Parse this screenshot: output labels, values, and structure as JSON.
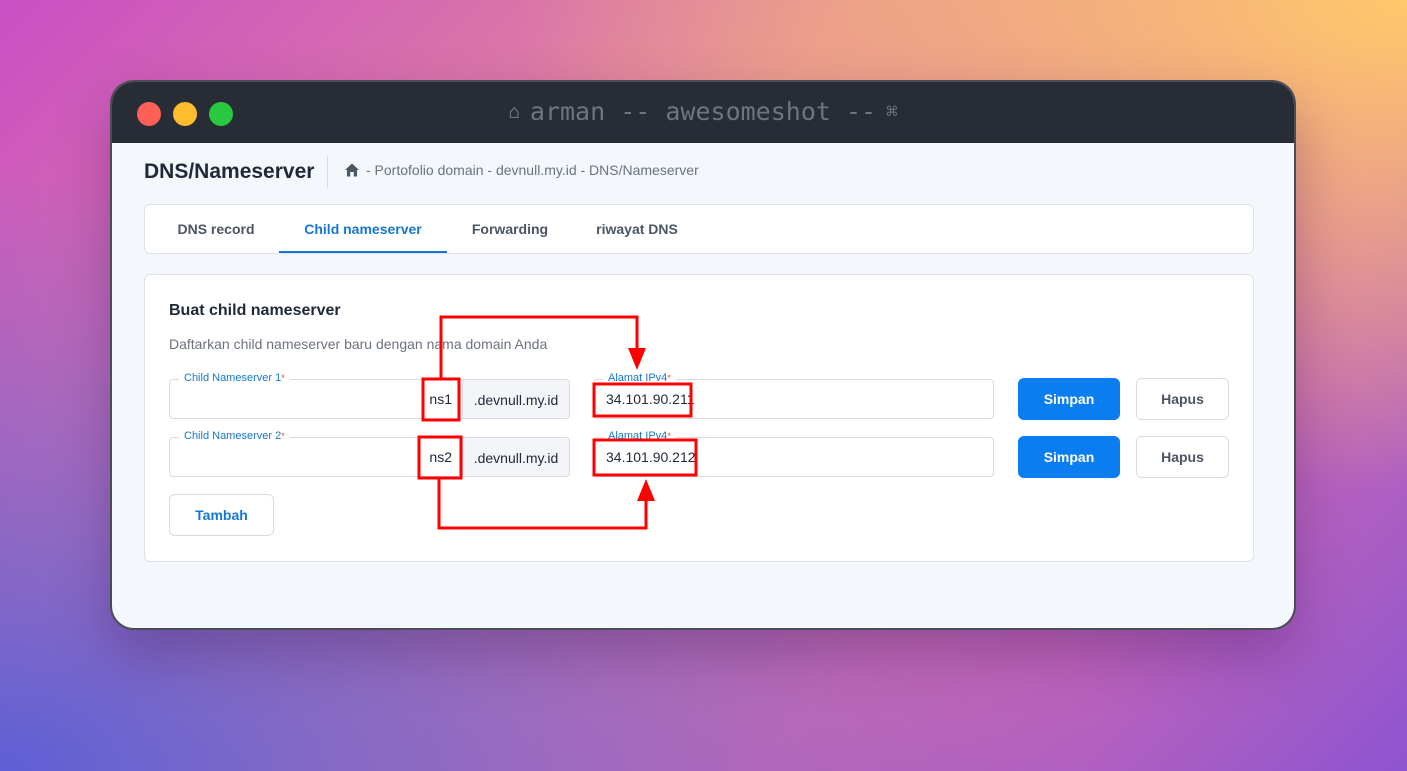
{
  "window": {
    "title": "arman -- awesomeshot --",
    "home_icon": "home-icon",
    "cmd_icon": "command-icon"
  },
  "header": {
    "page_title": "DNS/Nameserver",
    "breadcrumb": "- Portofolio domain - devnull.my.id - DNS/Nameserver"
  },
  "tabs": [
    {
      "label": "DNS record",
      "active": false
    },
    {
      "label": "Child nameserver",
      "active": true
    },
    {
      "label": "Forwarding",
      "active": false
    },
    {
      "label": "riwayat DNS",
      "active": false
    }
  ],
  "form": {
    "title": "Buat child nameserver",
    "description": "Daftarkan child nameserver baru dengan nama domain Anda",
    "rows": [
      {
        "ns_label": "Child Nameserver 1",
        "ns_value": "ns1",
        "suffix": ".devnull.my.id",
        "ip_label": "Alamat IPv4",
        "ip_value": "34.101.90.211",
        "save_label": "Simpan",
        "delete_label": "Hapus"
      },
      {
        "ns_label": "Child Nameserver 2",
        "ns_value": "ns2",
        "suffix": ".devnull.my.id",
        "ip_label": "Alamat IPv4",
        "ip_value": "34.101.90.212",
        "save_label": "Simpan",
        "delete_label": "Hapus"
      }
    ],
    "required_mark": "*",
    "add_label": "Tambah"
  },
  "colors": {
    "accent": "#1677d2",
    "primary_button": "#0a7df0",
    "annotation": "#ff0000"
  }
}
